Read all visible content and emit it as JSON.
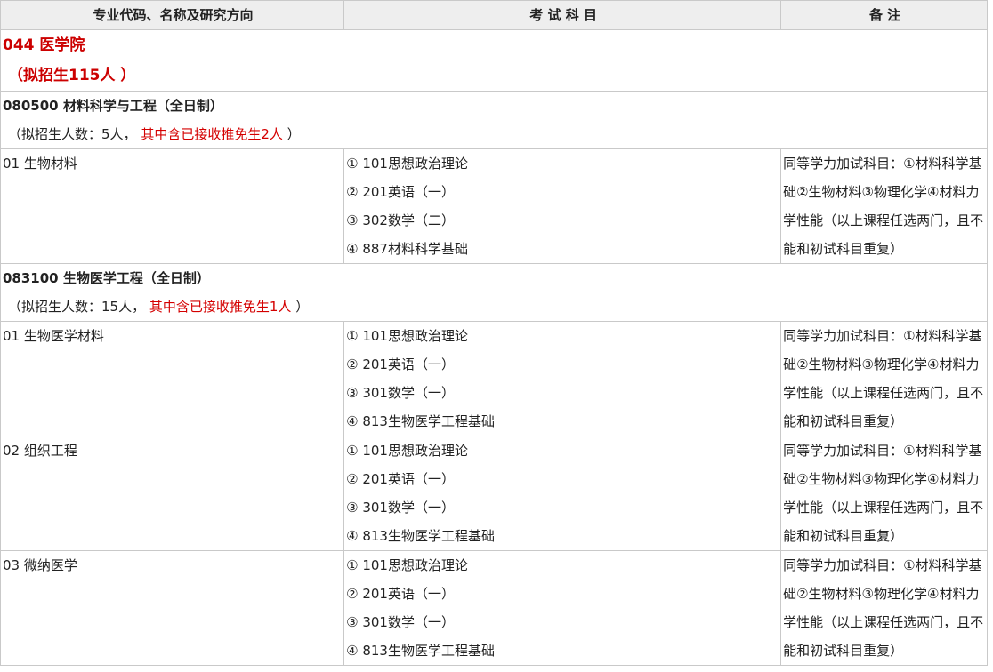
{
  "header": {
    "col1": "专业代码、名称及研究方向",
    "col2": "考 试 科 目",
    "col3": "备 注"
  },
  "department": {
    "name": "044 医学院",
    "quota": "（拟招生115人 ）"
  },
  "majors": [
    {
      "title": "080500 材料科学与工程（全日制）",
      "quota_prefix": "（拟招生人数：5人，",
      "quota_exempt": "其中含已接收推免生2人",
      "quota_suffix": "）",
      "directions": [
        {
          "name": "01 生物材料",
          "subjects": [
            "① 101思想政治理论",
            "② 201英语（一）",
            "③ 302数学（二）",
            "④ 887材料科学基础"
          ],
          "remark": "同等学力加试科目：①材料科学基础②生物材料③物理化学④材料力学性能（以上课程任选两门，且不能和初试科目重复）"
        }
      ]
    },
    {
      "title": "083100 生物医学工程（全日制）",
      "quota_prefix": "（拟招生人数：15人，",
      "quota_exempt": "其中含已接收推免生1人",
      "quota_suffix": "）",
      "directions": [
        {
          "name": "01 生物医学材料",
          "subjects": [
            "① 101思想政治理论",
            "② 201英语（一）",
            "③ 301数学（一）",
            "④ 813生物医学工程基础"
          ],
          "remark": "同等学力加试科目：①材料科学基础②生物材料③物理化学④材料力学性能（以上课程任选两门，且不能和初试科目重复）"
        },
        {
          "name": "02 组织工程",
          "subjects": [
            "① 101思想政治理论",
            "② 201英语（一）",
            "③ 301数学（一）",
            "④ 813生物医学工程基础"
          ],
          "remark": "同等学力加试科目：①材料科学基础②生物材料③物理化学④材料力学性能（以上课程任选两门，且不能和初试科目重复）"
        },
        {
          "name": "03 微纳医学",
          "subjects": [
            "① 101思想政治理论",
            "② 201英语（一）",
            "③ 301数学（一）",
            "④ 813生物医学工程基础"
          ],
          "remark": "同等学力加试科目：①材料科学基础②生物材料③物理化学④材料力学性能（以上课程任选两门，且不能和初试科目重复）"
        }
      ]
    }
  ]
}
